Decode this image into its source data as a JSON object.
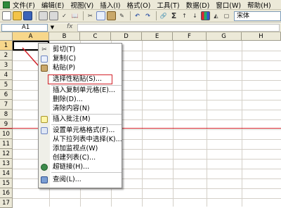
{
  "menubar": {
    "items": [
      "文件(F)",
      "编辑(E)",
      "视图(V)",
      "插入(I)",
      "格式(O)",
      "工具(T)",
      "数据(D)",
      "窗口(W)",
      "帮助(H)"
    ]
  },
  "toolbar": {
    "font_name": "宋体",
    "sigma": "Σ"
  },
  "formula": {
    "cell_ref": "A1",
    "fx": "fx"
  },
  "grid": {
    "columns": [
      "A",
      "B",
      "C",
      "D",
      "E",
      "F",
      "G",
      "H"
    ],
    "rows": [
      "1",
      "2",
      "3",
      "4",
      "5",
      "6",
      "7",
      "8",
      "9",
      "10",
      "11",
      "12",
      "13",
      "14",
      "15",
      "16",
      "17"
    ]
  },
  "context_menu": {
    "items": [
      {
        "label": "剪切(T)",
        "icon": "scissors-icon"
      },
      {
        "label": "复制(C)",
        "icon": "copy-icon"
      },
      {
        "label": "粘贴(P)",
        "icon": "paste-icon"
      },
      {
        "label": "选择性粘贴(S)...",
        "icon": ""
      },
      {
        "label": "插入复制单元格(E)...",
        "icon": ""
      },
      {
        "label": "删除(D)...",
        "icon": ""
      },
      {
        "label": "清除内容(N)",
        "icon": ""
      },
      {
        "label": "插入批注(M)",
        "icon": "comment-icon"
      },
      {
        "label": "设置单元格格式(F)...",
        "icon": "format-cells-icon"
      },
      {
        "label": "从下拉列表中选择(K)...",
        "icon": ""
      },
      {
        "label": "添加监视点(W)",
        "icon": ""
      },
      {
        "label": "创建列表(C)...",
        "icon": ""
      },
      {
        "label": "超链接(H)...",
        "icon": "hyperlink-icon"
      },
      {
        "label": "查阅(L)...",
        "icon": "research-icon"
      }
    ]
  },
  "colors": {
    "annotation_red": "#d3222a",
    "menubar_bg": "#ece9d8",
    "active_header": "#f7d78b"
  }
}
